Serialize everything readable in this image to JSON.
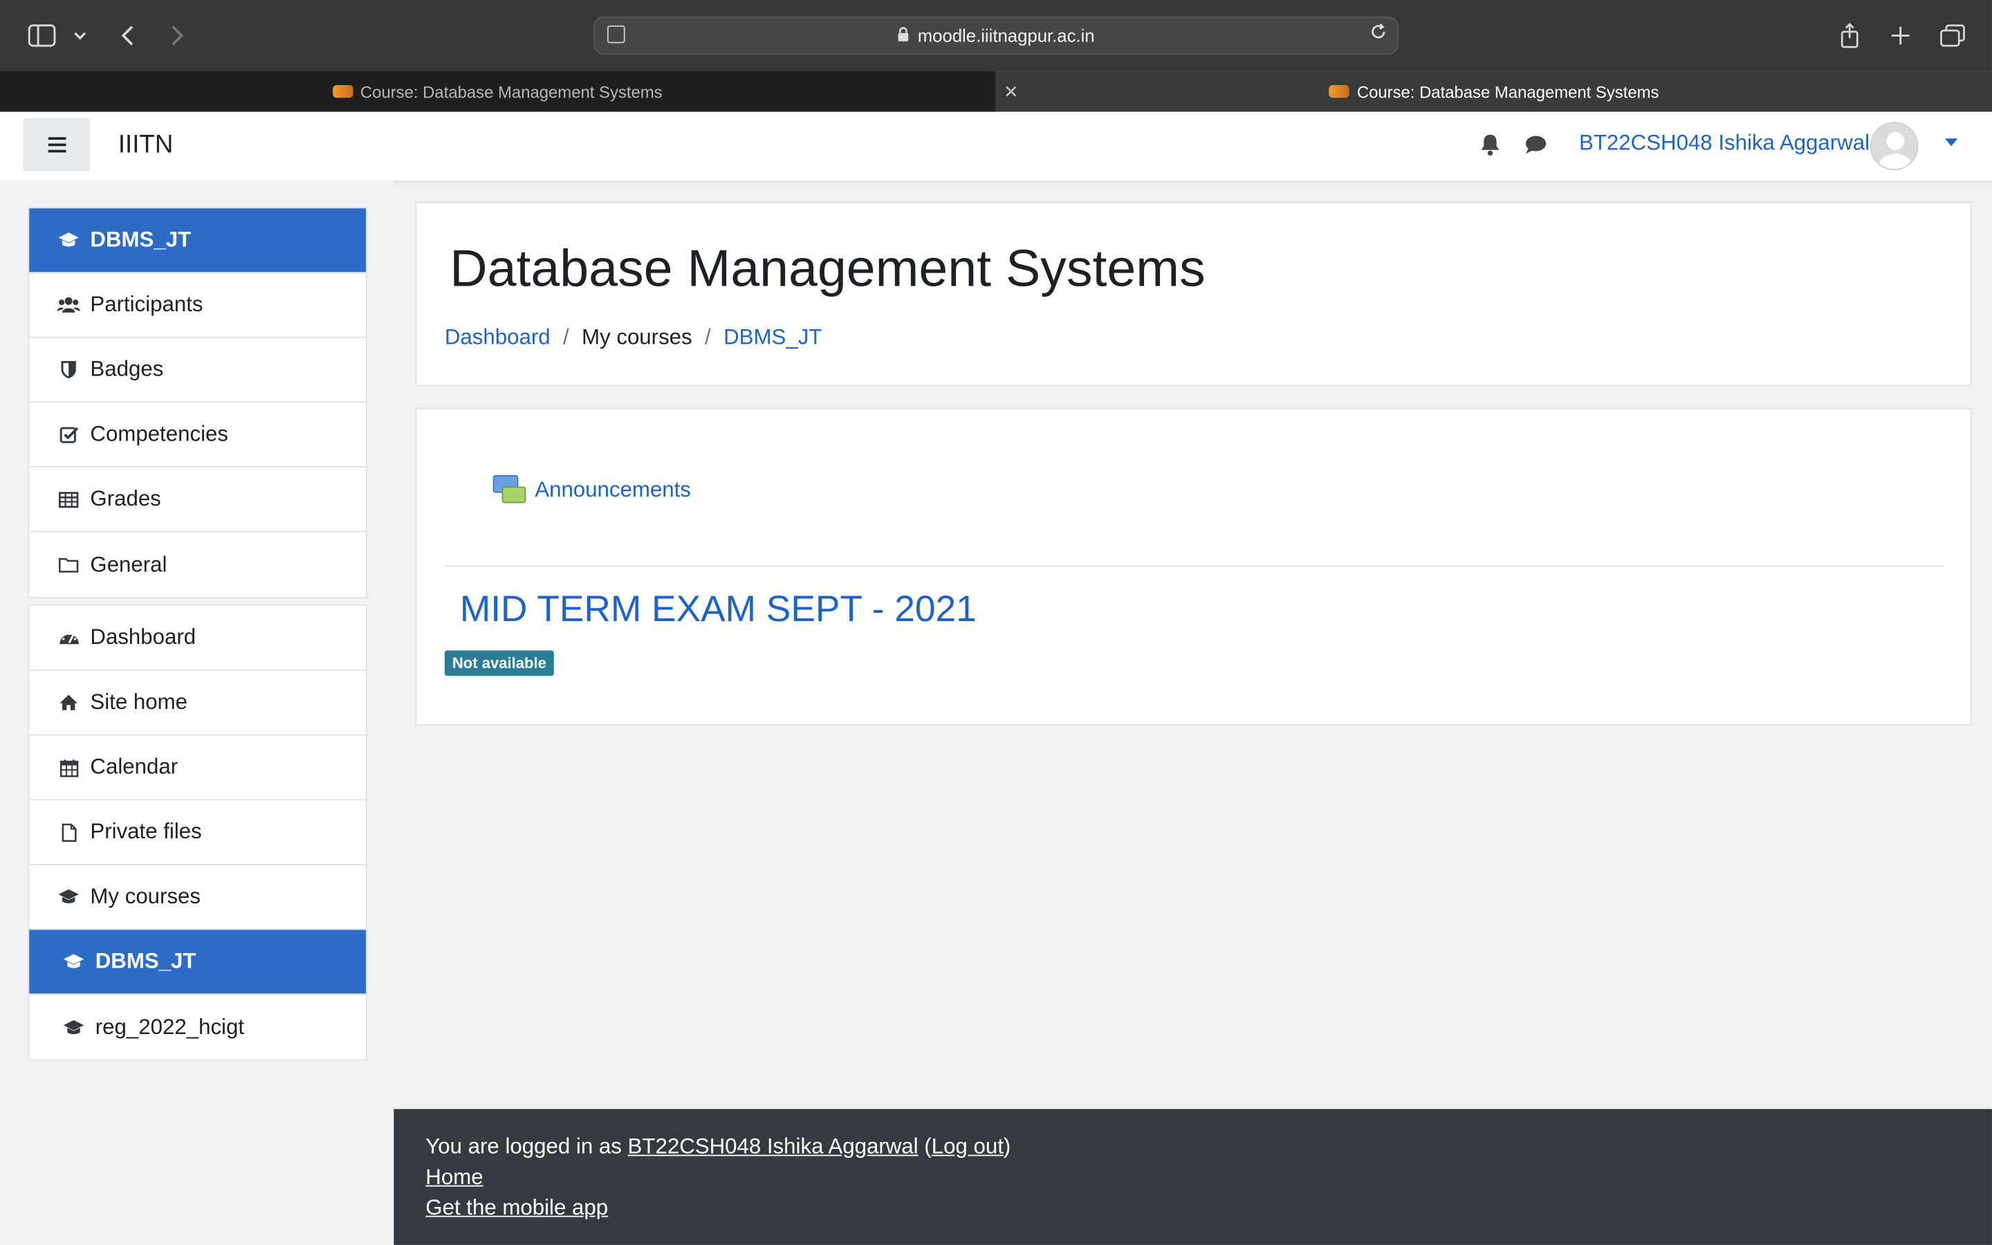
{
  "browser": {
    "url": "moodle.iiitnagpur.ac.in",
    "tabs": [
      {
        "title": "Course: Database Management Systems",
        "active": false
      },
      {
        "title": "Course: Database Management Systems",
        "active": true
      }
    ]
  },
  "navbar": {
    "site_name": "IIITN",
    "user_name": "BT22CSH048 Ishika Aggarwal"
  },
  "sidebar": {
    "course_group": [
      {
        "label": "DBMS_JT",
        "icon": "graduation-cap-icon",
        "active": true
      },
      {
        "label": "Participants",
        "icon": "users-icon",
        "active": false
      },
      {
        "label": "Badges",
        "icon": "shield-icon",
        "active": false
      },
      {
        "label": "Competencies",
        "icon": "checkbox-icon",
        "active": false
      },
      {
        "label": "Grades",
        "icon": "table-icon",
        "active": false
      },
      {
        "label": "General",
        "icon": "folder-icon",
        "active": false
      }
    ],
    "site_group": [
      {
        "label": "Dashboard",
        "icon": "dashboard-icon",
        "active": false
      },
      {
        "label": "Site home",
        "icon": "home-icon",
        "active": false
      },
      {
        "label": "Calendar",
        "icon": "calendar-icon",
        "active": false
      },
      {
        "label": "Private files",
        "icon": "file-icon",
        "active": false
      },
      {
        "label": "My courses",
        "icon": "graduation-cap-icon",
        "active": false
      },
      {
        "label": "DBMS_JT",
        "icon": "graduation-cap-icon",
        "active": true
      },
      {
        "label": "reg_2022_hcigt",
        "icon": "graduation-cap-icon",
        "active": false
      }
    ]
  },
  "header": {
    "title": "Database Management Systems",
    "breadcrumb": [
      "Dashboard",
      "My courses",
      "DBMS_JT"
    ]
  },
  "content": {
    "forum_label": "Announcements",
    "section_title": "MID TERM EXAM SEPT - 2021",
    "badge": "Not available"
  },
  "footer": {
    "logged_in_prefix": "You are logged in as",
    "user_name": "BT22CSH048 Ishika Aggarwal",
    "logout": "Log out",
    "home": "Home",
    "mobile_app": "Get the mobile app"
  },
  "colors": {
    "accent": "#2e6bc6",
    "link": "#1f63c4",
    "badge": "#2a7d94",
    "footer_bg": "#343a40"
  }
}
